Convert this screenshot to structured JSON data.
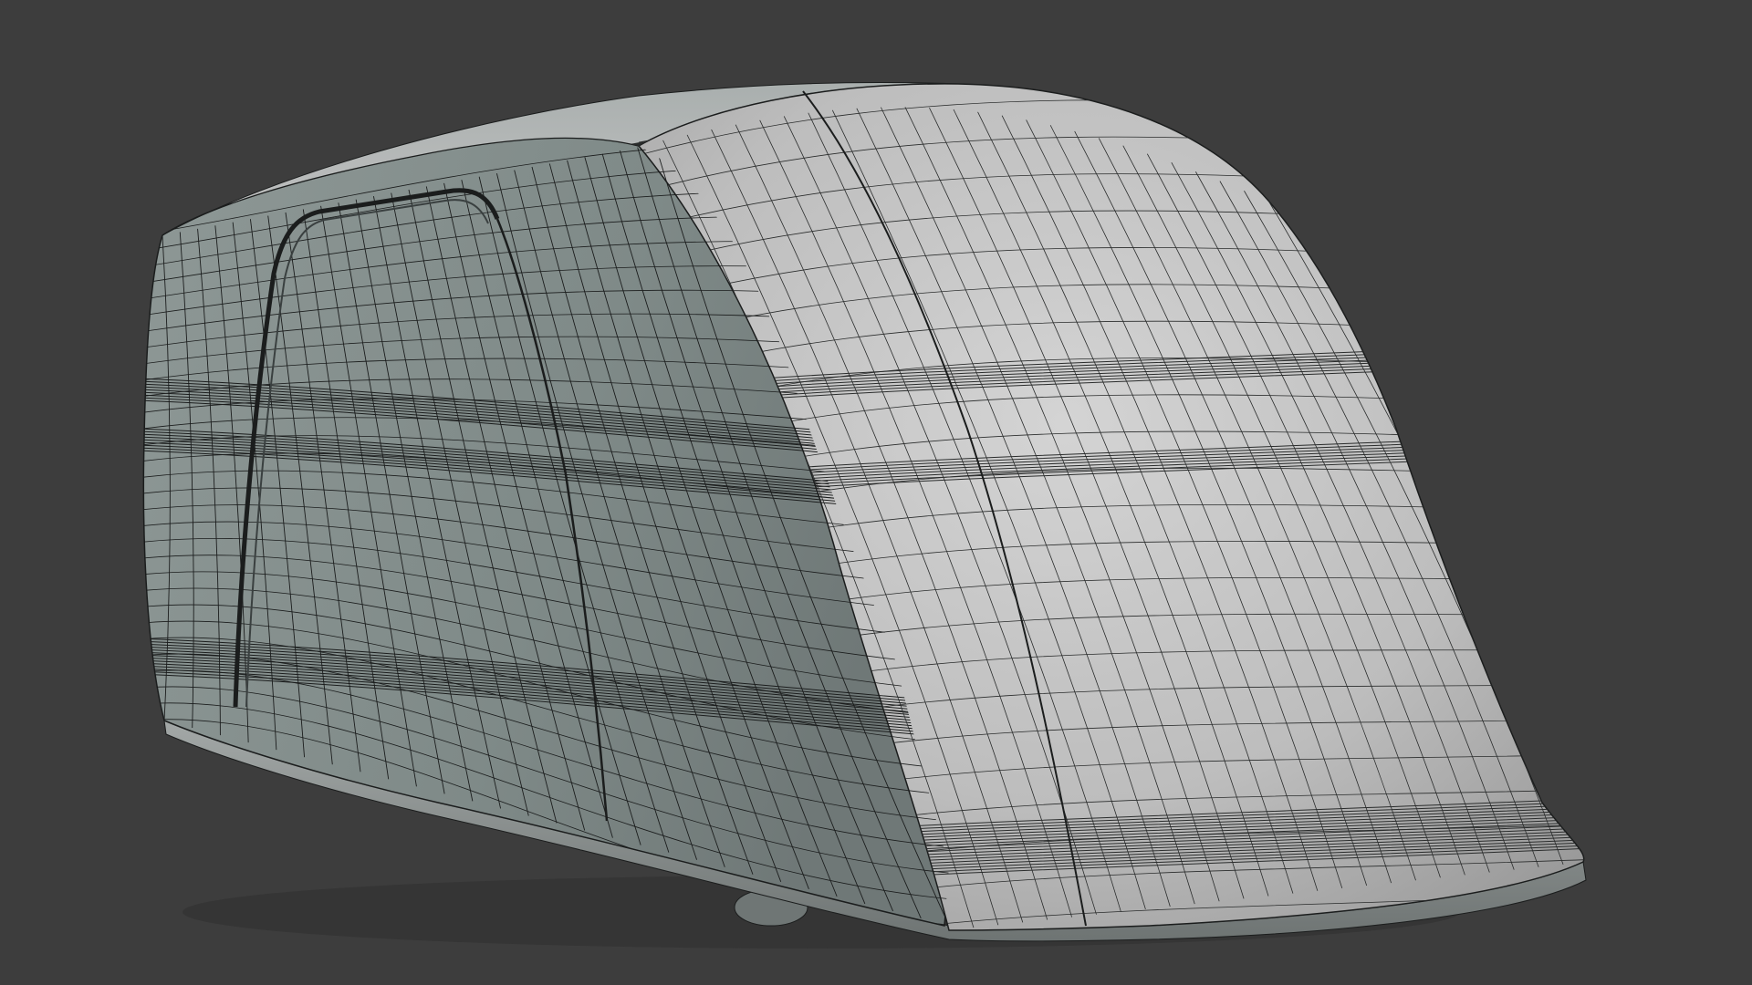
{
  "viewport": {
    "background_color": "#3d3d3d",
    "shading_mode": "solid",
    "overlay": "wireframe"
  },
  "model": {
    "subject": "vehicle-body-mesh",
    "side_surface_color": "#86918f",
    "front_surface_color": "#c4c4c4",
    "roof_surface_color": "#b9b9b9",
    "edge_color": "#1b1d1d",
    "wheel_color": "#6f7675"
  }
}
